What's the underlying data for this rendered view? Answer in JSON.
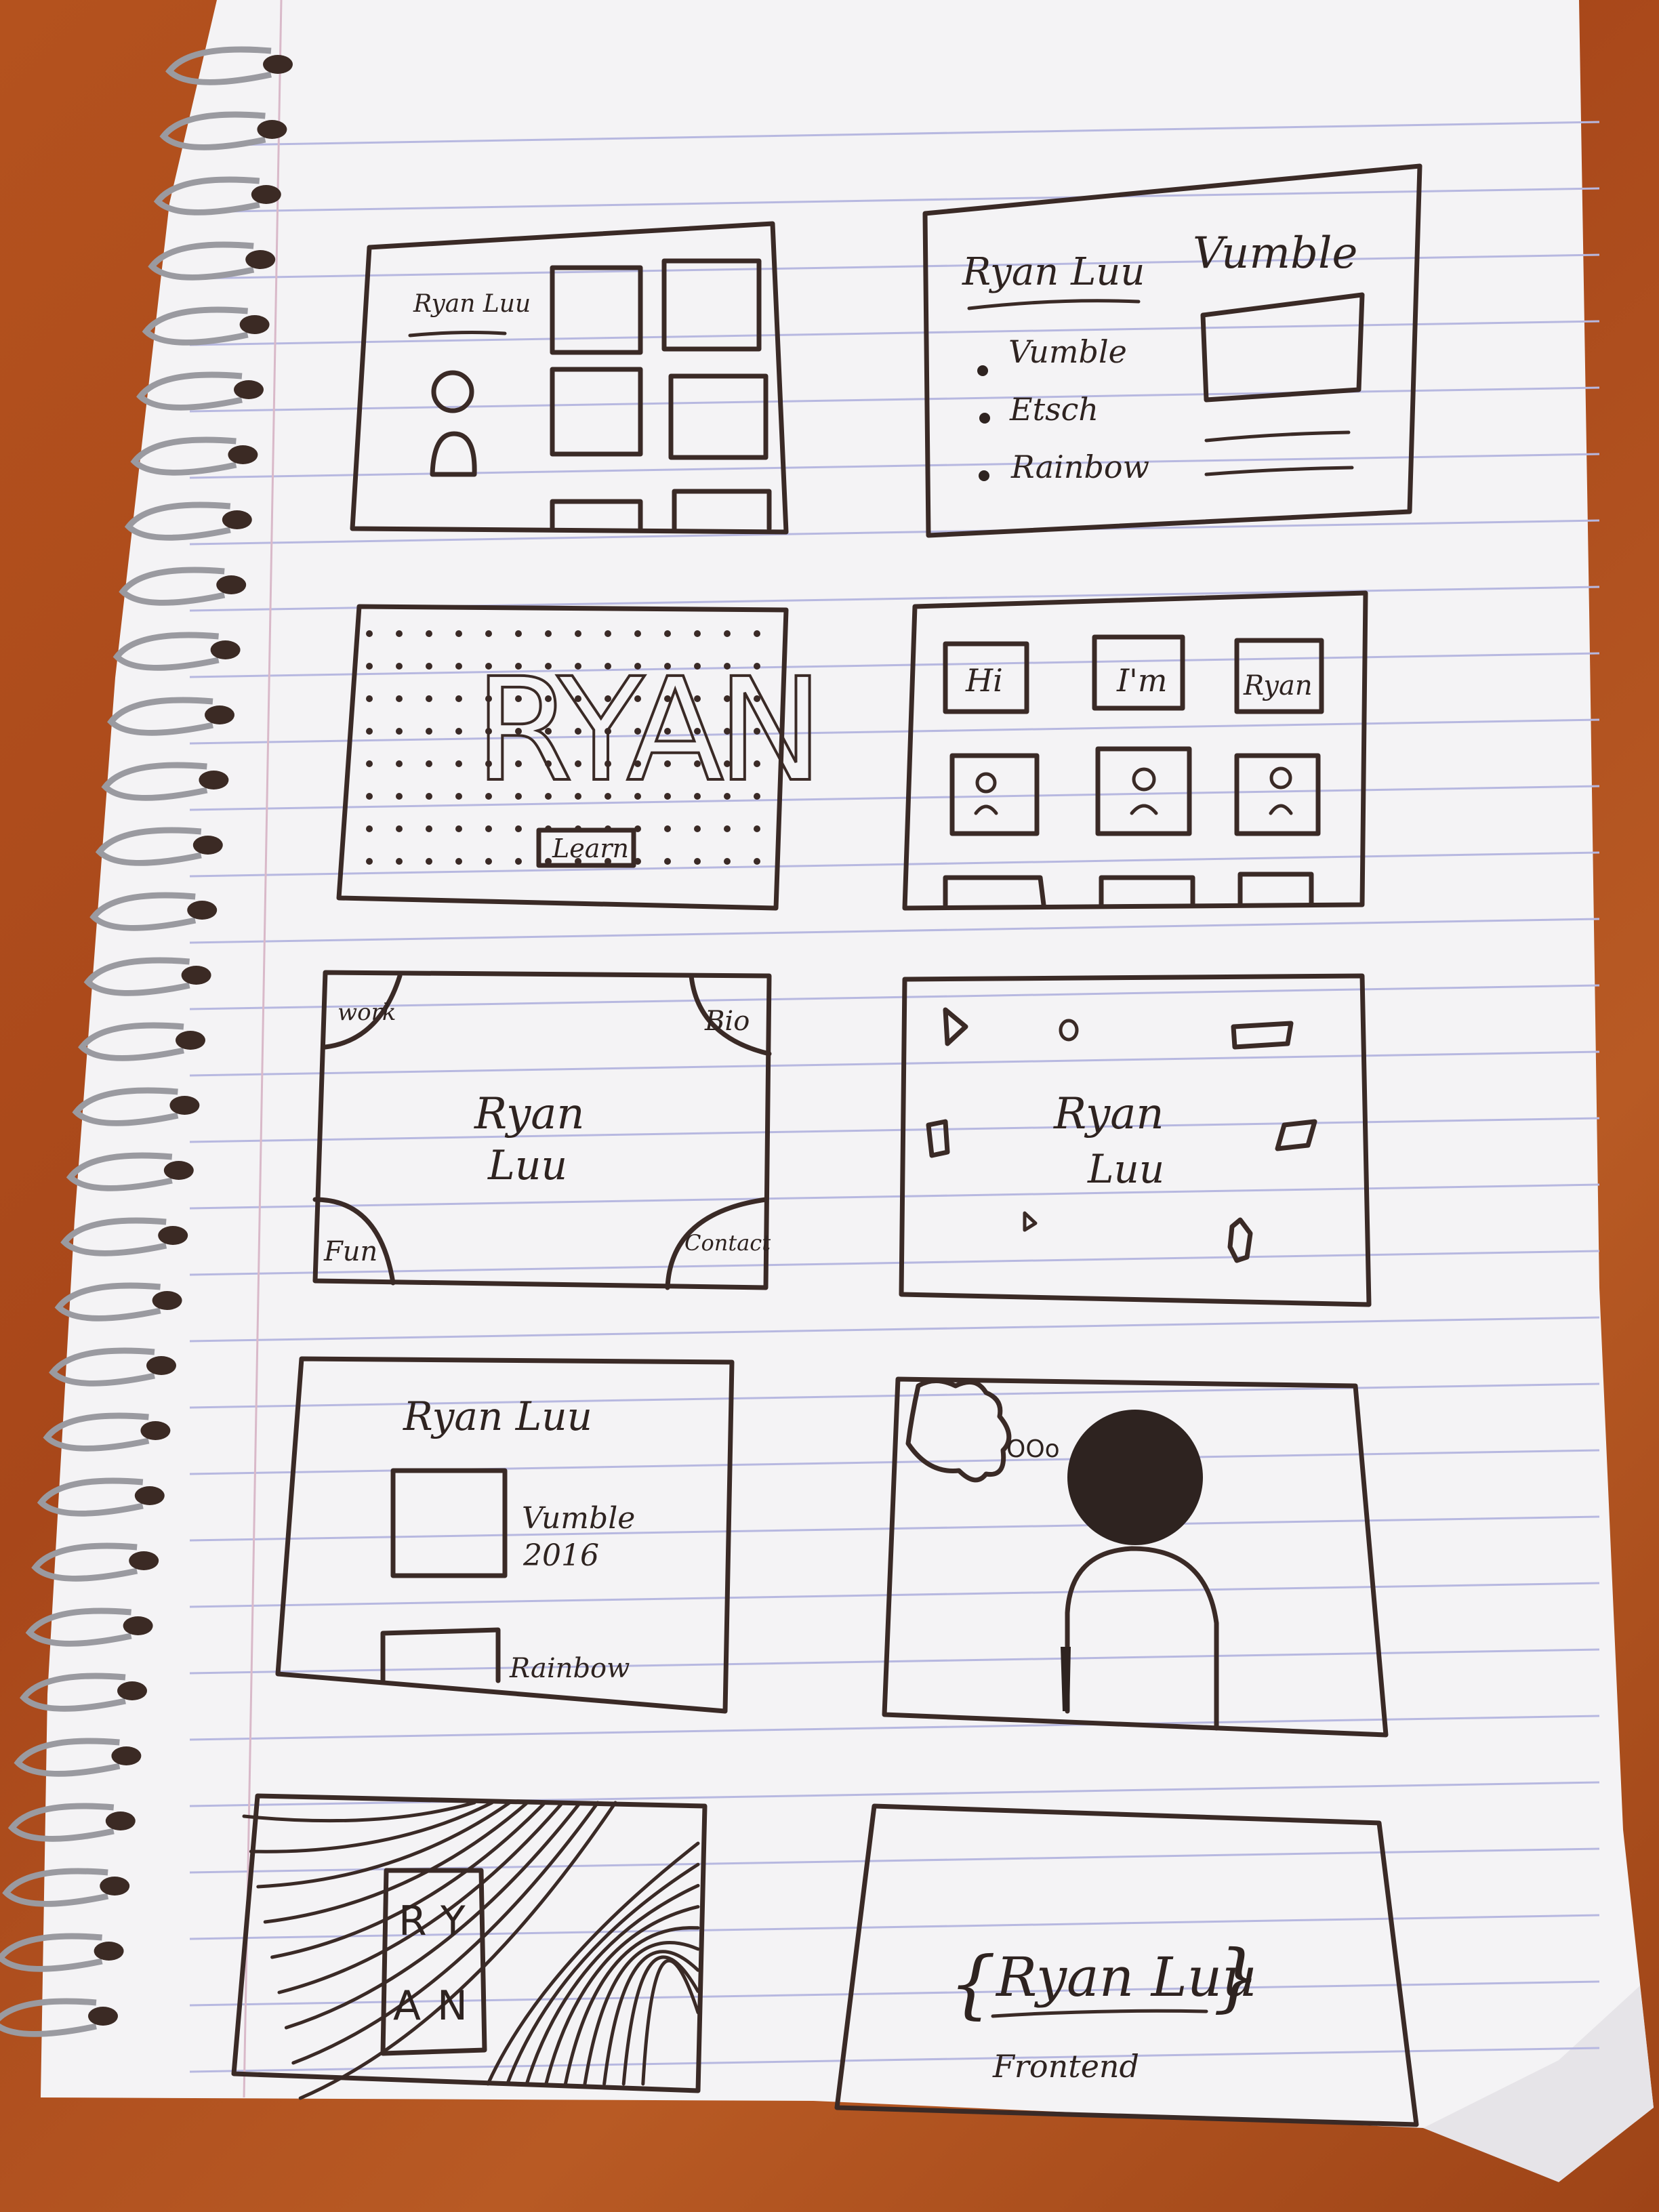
{
  "colors": {
    "desk": "#b04f1d",
    "paper": "#f4f3f5",
    "rule_line": "#b7b8e0",
    "ink": "#3a2a26",
    "ring": "#9a9aa0"
  },
  "sketch1": {
    "name_label": "Ryan Luu"
  },
  "sketch2": {
    "name_label": "Ryan Luu",
    "project_title": "Vumble",
    "list_items": [
      "Vumble",
      "Etsch",
      "Rainbow"
    ]
  },
  "sketch3": {
    "big_word": "RYAN",
    "button_label": "Learn"
  },
  "sketch4": {
    "word_boxes": [
      "Hi",
      "I'm",
      "Ryan"
    ]
  },
  "sketch5": {
    "name_line1": "Ryan",
    "name_line2": "Luu",
    "corner_top_left": "work",
    "corner_top_right": "Bio",
    "corner_bottom_left": "Fun",
    "corner_bottom_right": "Contact"
  },
  "sketch6": {
    "name_line1": "Ryan",
    "name_line2": "Luu"
  },
  "sketch7": {
    "name_label": "Ryan Luu",
    "project_name": "Vumble",
    "project_year": "2016",
    "second_project": "Rainbow"
  },
  "sketch8": {
    "thought_dots": "OOo"
  },
  "sketch9": {
    "letters": [
      "R",
      "Y",
      "A",
      "N"
    ]
  },
  "sketch10": {
    "name_label": "Ryan Luu",
    "role_label": "Frontend",
    "brace_left": "{",
    "brace_right": "}"
  }
}
